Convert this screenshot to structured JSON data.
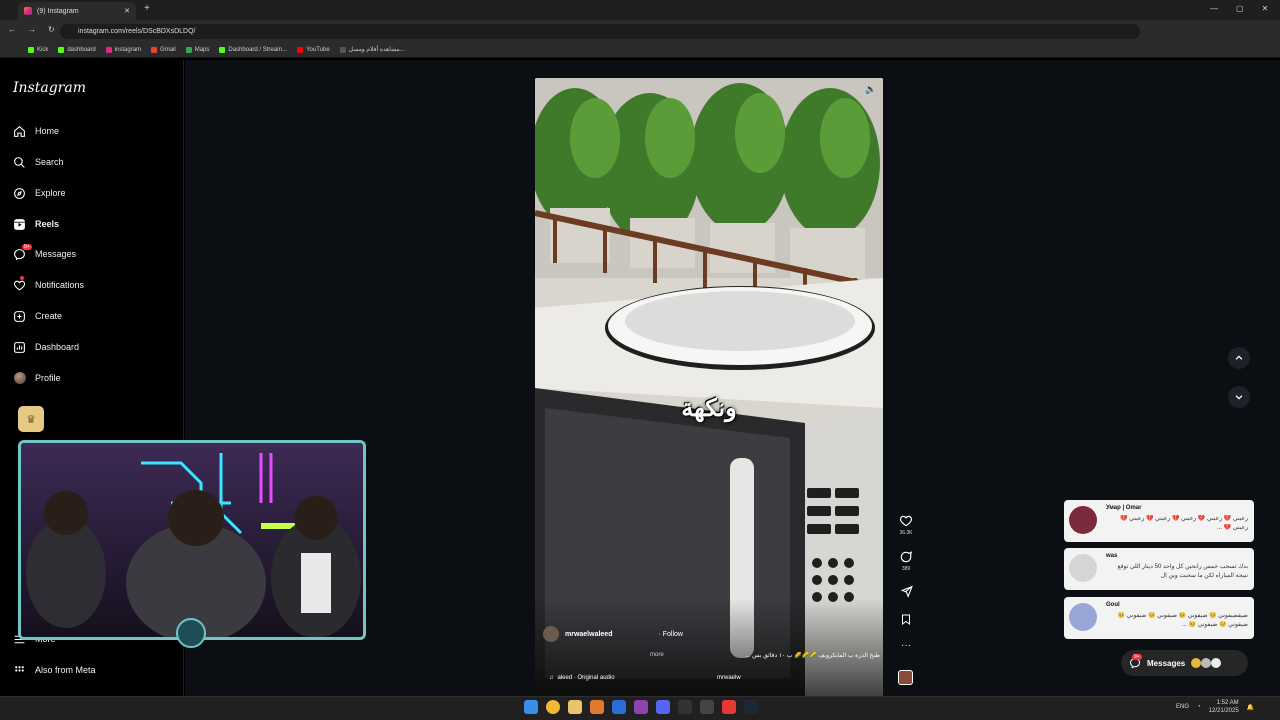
{
  "browser": {
    "tab_title": "(9) Instagram",
    "url": "instagram.com/reels/DScBDXsDLDQ/",
    "bookmarks": [
      "Kick",
      "dashboard",
      "instagram",
      "Gmail",
      "Maps",
      "Dashboard / Stream...",
      "YouTube",
      "مشاهدة أفلام ومسل..."
    ]
  },
  "sidebar": {
    "logo": "Instagram",
    "items": [
      {
        "label": "Home",
        "icon": "home-icon"
      },
      {
        "label": "Search",
        "icon": "search-icon"
      },
      {
        "label": "Explore",
        "icon": "compass-icon"
      },
      {
        "label": "Reels",
        "icon": "reels-icon"
      },
      {
        "label": "Messages",
        "icon": "messenger-icon"
      },
      {
        "label": "Notifications",
        "icon": "heart-icon"
      },
      {
        "label": "Create",
        "icon": "plus-icon"
      },
      {
        "label": "Dashboard",
        "icon": "dashboard-icon"
      },
      {
        "label": "Profile",
        "icon": "avatar"
      }
    ],
    "messages_badge": "9+",
    "more_label": "More",
    "also_from_meta": "Also from Meta"
  },
  "reel": {
    "caption_overlay": "ونكهة",
    "username": "mrwaelwaleed",
    "follow_label": "Follow",
    "description": "طبخ الذرة ب المايكرويف 🌽🌽🌽 ب ١٠ دقائق بس ...",
    "more_label": "more",
    "audio": "aleed · Original audio",
    "audio_user": "mrwaelw",
    "likes": "36.3K",
    "comments": "389"
  },
  "chat": [
    {
      "name": "Умар | Omar",
      "message": "رعبني 💔 رعبني 💔 رعبني 💔 رعبني 💔 رعبني 💔 رعبني 💔 ..."
    },
    {
      "name": "was",
      "message": "بدك تسحب خمس رابحين كل واحد 50 دينار اللي توقع نتيجه المباراه لكن ما سحبت وين ال"
    },
    {
      "name": "Goul",
      "message": "ضيفضيفوني 🥺 ضيفوني 🥺 ضيفوني 🥺 ضيفوني 🥺 ضيفوني 🥺 ضيفوني 🥺 ..."
    }
  ],
  "messages_pill": {
    "label": "Messages",
    "badge": "9+"
  },
  "taskbar": {
    "lang": "ENG",
    "time": "1:52 AM",
    "date": "12/21/2025"
  },
  "colors": {
    "accent": "#0095f6",
    "badge": "#ff3040",
    "cam_border": "#6fc6c5"
  }
}
